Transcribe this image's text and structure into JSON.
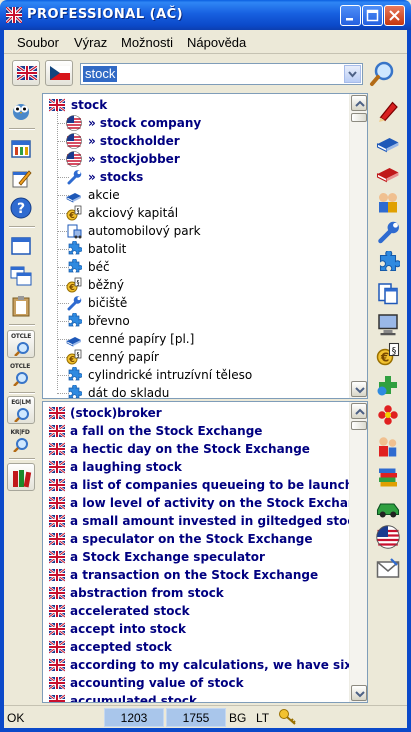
{
  "window": {
    "title": "PROFESSIONAL (AČ)"
  },
  "menu": [
    "Soubor",
    "Výraz",
    "Možnosti",
    "Nápověda"
  ],
  "search": {
    "value": "stock"
  },
  "left_toolbar": [
    {
      "icon": "owl-icon"
    },
    {
      "icon": "library-icon"
    },
    {
      "icon": "edit-note-icon"
    },
    {
      "icon": "help-icon"
    },
    {
      "icon": "window-icon"
    },
    {
      "icon": "cascade-windows-icon"
    },
    {
      "icon": "clipboard-icon"
    },
    {
      "icon": "otcle-search-icon",
      "label": "OTCLE"
    },
    {
      "icon": "otcle-search-small-icon",
      "label": "OTCLE"
    },
    {
      "icon": "eglm-search-icon",
      "label": "EG|LM"
    },
    {
      "icon": "krfd-search-icon",
      "label": "KR|FD"
    },
    {
      "icon": "books-icon"
    }
  ],
  "top_list": [
    {
      "text": "stock",
      "icon": "flag-uk-icon",
      "bold": true,
      "indent": 0
    },
    {
      "text": "» stock company",
      "icon": "flag-us-icon",
      "bold": true,
      "indent": 1
    },
    {
      "text": "» stockholder",
      "icon": "flag-us-icon",
      "bold": true,
      "indent": 1
    },
    {
      "text": "» stockjobber",
      "icon": "flag-us-icon",
      "bold": true,
      "indent": 1
    },
    {
      "text": "» stocks",
      "icon": "wrench-icon",
      "bold": true,
      "indent": 1
    },
    {
      "text": "akcie",
      "icon": "book-icon",
      "bold": false,
      "indent": 1
    },
    {
      "text": "akciový kapitál",
      "icon": "economy-icon",
      "bold": false,
      "indent": 1
    },
    {
      "text": "automobilový park",
      "icon": "car-icon",
      "bold": false,
      "indent": 1
    },
    {
      "text": "batolit",
      "icon": "puzzle-icon",
      "bold": false,
      "indent": 1
    },
    {
      "text": "béč",
      "icon": "puzzle-icon",
      "bold": false,
      "indent": 1
    },
    {
      "text": "běžný",
      "icon": "economy-icon",
      "bold": false,
      "indent": 1
    },
    {
      "text": "bičiště",
      "icon": "wrench-icon",
      "bold": false,
      "indent": 1
    },
    {
      "text": "břevno",
      "icon": "puzzle-icon",
      "bold": false,
      "indent": 1
    },
    {
      "text": "cenné papíry [pl.]",
      "icon": "book-icon",
      "bold": false,
      "indent": 1
    },
    {
      "text": "cenný papír",
      "icon": "economy-icon",
      "bold": false,
      "indent": 1
    },
    {
      "text": "cylindrické intruzívní těleso",
      "icon": "puzzle-icon",
      "bold": false,
      "indent": 1
    },
    {
      "text": "dát do skladu",
      "icon": "puzzle-icon",
      "bold": false,
      "indent": 1
    }
  ],
  "bottom_list": [
    "(stock)broker",
    "a fall on the Stock Exchange",
    "a hectic day on the Stock Exchange",
    "a laughing stock",
    "a list of companies queueing to be launched",
    "a low level of activity on the Stock Exchange",
    "a small amount invested in giltedged stock",
    "a speculator on the Stock Exchange",
    "a Stock Exchange speculator",
    "a transaction on the Stock Exchange",
    "abstraction from stock",
    "accelerated stock",
    "accept into stock",
    "accepted stock",
    "according to my calculations, we have six months",
    "accounting value of stock",
    "accumulated stock"
  ],
  "right_toolbar": [
    "pencil-icon",
    "book-blue-icon",
    "book-red-icon",
    "people-icon",
    "wrench-icon",
    "puzzle-icon",
    "documents-icon",
    "computer-icon",
    "economy-icon",
    "medicine-icon",
    "flower-icon",
    "family-icon",
    "book-stack-icon",
    "car-icon",
    "flag-us-icon",
    "mail-icon"
  ],
  "status": {
    "text": "OK",
    "count1": "1203",
    "count2": "1755",
    "lang1": "BG",
    "lang2": "LT"
  },
  "colors": {
    "titlebar": "#0b49c9",
    "selection": "#316ac5",
    "bold_text": "#000080",
    "status_box": "#a9c6eb"
  }
}
